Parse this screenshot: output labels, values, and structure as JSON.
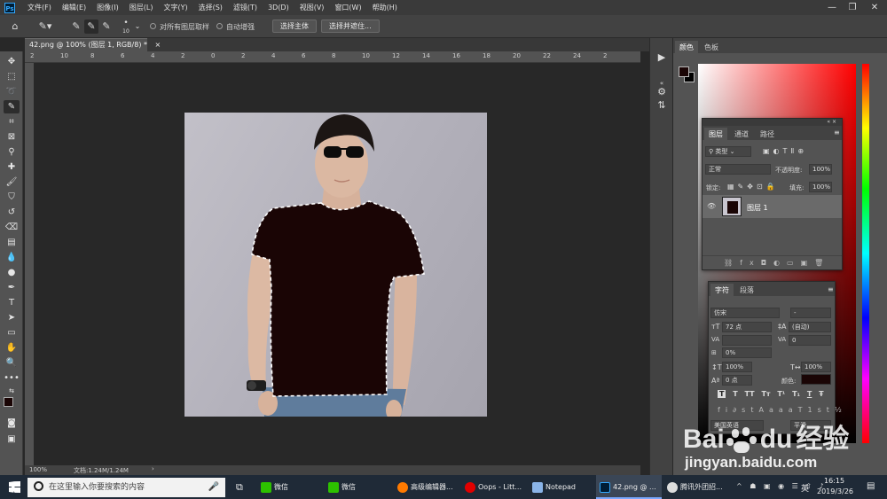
{
  "menubar": {
    "app_icon": "ps-logo",
    "app_icon_text": "Ps",
    "items": [
      "文件(F)",
      "编辑(E)",
      "图像(I)",
      "图层(L)",
      "文字(Y)",
      "选择(S)",
      "滤镜(T)",
      "3D(D)",
      "视图(V)",
      "窗口(W)",
      "帮助(H)"
    ],
    "window_controls": [
      "—",
      "❐",
      "✕"
    ]
  },
  "optionsbar": {
    "brush_size": "10",
    "sample_all_layers": "对所有图层取样",
    "auto_enhance": "自动增强",
    "select_subject": "选择主体",
    "select_and_mask": "选择并遮住..."
  },
  "document": {
    "tab_title": "42.png @ 100% (图层 1, RGB/8) *",
    "tab_close": "×",
    "zoom": "100%",
    "doc_info": "文档:1.24M/1.24M",
    "ruler_labels": [
      "2",
      "10",
      "8",
      "6",
      "4",
      "2",
      "0",
      "2",
      "4",
      "6",
      "8",
      "10",
      "12",
      "14",
      "16",
      "18",
      "20",
      "22",
      "24",
      "2"
    ]
  },
  "colorpanel": {
    "tabs": [
      "颜色",
      "色板"
    ],
    "foreground": "#1a0505",
    "background": "#000000"
  },
  "layers": {
    "tabs": [
      "图层",
      "通道",
      "路径"
    ],
    "filter_kind": "类型",
    "blend_mode": "正常",
    "opacity_label": "不透明度:",
    "opacity": "100%",
    "lock_label": "锁定:",
    "fill_label": "填充:",
    "fill": "100%",
    "layer_name": "图层 1"
  },
  "character": {
    "tabs": [
      "字符",
      "段落"
    ],
    "font_family": "仿宋",
    "font_style": "-",
    "size": "72 点",
    "leading": "(自动)",
    "kerning": "",
    "tracking": "0",
    "scale_pct": "0%",
    "vscale": "100%",
    "hscale": "100%",
    "baseline": "0 点",
    "color_label": "颜色:",
    "color": "#1a0505",
    "style_buttons": [
      "T",
      "T",
      "TT",
      "Tт",
      "T¹",
      "T₁",
      "T",
      "Ŧ"
    ],
    "language": "美国英语",
    "aa": "平滑"
  },
  "taskbar": {
    "search_placeholder": "在这里输入你要搜索的内容",
    "apps": [
      "微信",
      "微信",
      "高级编辑器...",
      "Oops - Litt...",
      "Notepad",
      "42.png @ ...",
      "腾讯外团招..."
    ],
    "tray": "英",
    "time": "16:15",
    "date": "2019/3/26"
  },
  "watermark": {
    "brand": "Bai",
    "brand2": "du",
    "cn": "经验",
    "url": "jingyan.baidu.com"
  }
}
